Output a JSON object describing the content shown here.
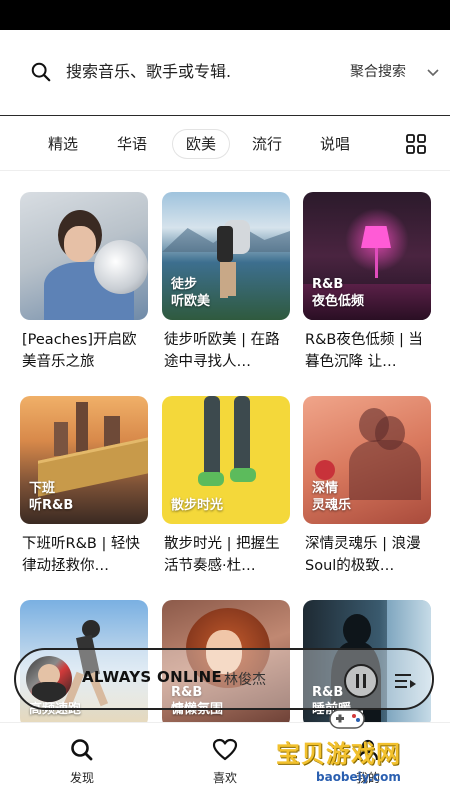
{
  "search": {
    "placeholder": "搜索音乐、歌手或专辑.",
    "mode_label": "聚合搜索"
  },
  "tabs": [
    {
      "label": "精选",
      "active": false
    },
    {
      "label": "华语",
      "active": false
    },
    {
      "label": "欧美",
      "active": true
    },
    {
      "label": "流行",
      "active": false
    },
    {
      "label": "说唱",
      "active": false
    }
  ],
  "cards": [
    {
      "tag": "",
      "title": "[Peaches]开启欧美音乐之旅"
    },
    {
      "tag": "徒步\n听欧美",
      "title": "徒步听欧美 | 在路途中寻找人…"
    },
    {
      "tag": "R&B\n夜色低频",
      "title": "R&B夜色低频 | 当暮色沉降 让…"
    },
    {
      "tag": "下班\n听R&B",
      "title": "下班听R&B | 轻快律动拯救你…"
    },
    {
      "tag": "散步时光",
      "title": "散步时光 | 把握生活节奏感·杜…"
    },
    {
      "tag": "深情\n灵魂乐",
      "title": "深情灵魂乐 | 浪漫Soul的极致…"
    },
    {
      "tag": "高频速跑",
      "title": ""
    },
    {
      "tag": "R&B\n慵懒氛围",
      "title": ""
    },
    {
      "tag": "R&B\n睡前暖…",
      "title": ""
    }
  ],
  "mini_player": {
    "song": "ALWAYS ONLINE",
    "artist": "林俊杰"
  },
  "bottom_nav": [
    {
      "label": "发现",
      "icon": "search-icon"
    },
    {
      "label": "喜欢",
      "icon": "heart-icon"
    },
    {
      "label": "我的",
      "icon": "user-icon"
    }
  ],
  "watermark": {
    "text": "宝贝游戏网",
    "url": "baobeiy.com"
  },
  "colors": {
    "accent": "#000000",
    "watermark_yellow": "#f2c12e",
    "watermark_blue": "#2a5fb0"
  }
}
